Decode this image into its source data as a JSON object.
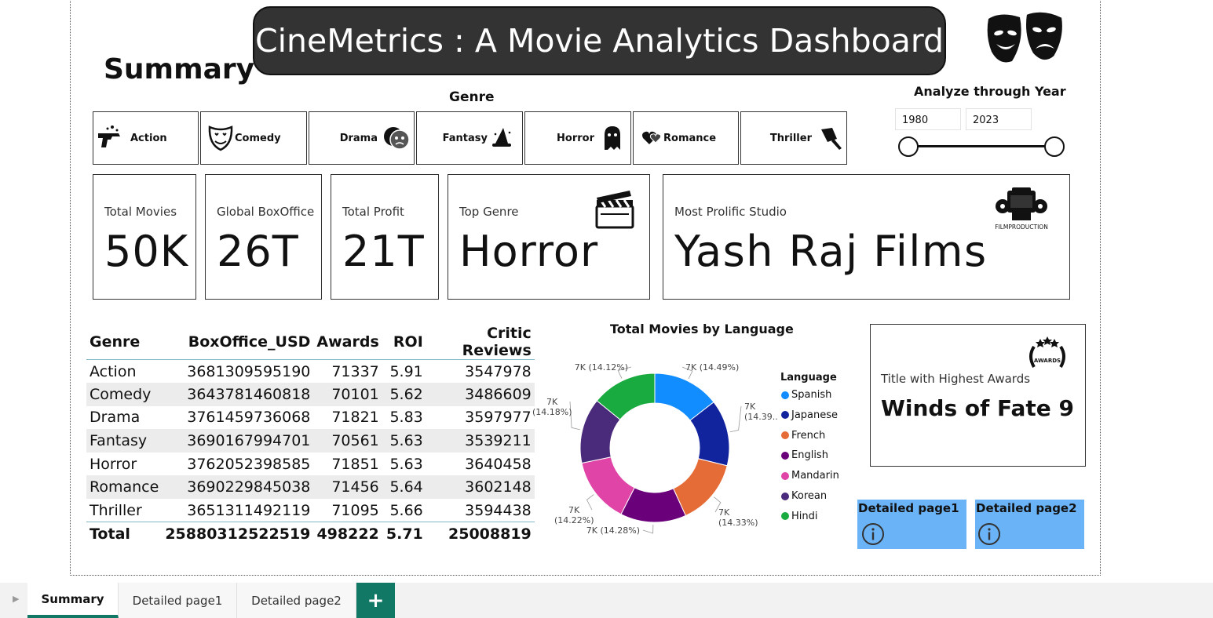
{
  "banner": {
    "title": "CineMetrics : A Movie Analytics Dashboard"
  },
  "page": {
    "heading": "Summary"
  },
  "genre_slicer": {
    "title": "Genre",
    "items": [
      {
        "label": "Action",
        "icon": "gun-icon"
      },
      {
        "label": "Comedy",
        "icon": "jester-mask-icon"
      },
      {
        "label": "Drama",
        "icon": "theatre-masks-icon"
      },
      {
        "label": "Fantasy",
        "icon": "witch-hat-icon"
      },
      {
        "label": "Horror",
        "icon": "ghost-icon"
      },
      {
        "label": "Romance",
        "icon": "hearts-icon"
      },
      {
        "label": "Thriller",
        "icon": "cleaver-icon"
      }
    ]
  },
  "year_slicer": {
    "title": "Analyze through Year",
    "from": "1980",
    "to": "2023"
  },
  "kpis": {
    "total_movies": {
      "label": "Total Movies",
      "value": "50K"
    },
    "global_boxoffice": {
      "label": "Global BoxOffice",
      "value": "26T"
    },
    "total_profit": {
      "label": "Total Profit",
      "value": "21T"
    },
    "top_genre": {
      "label": "Top Genre",
      "value": "Horror"
    },
    "prolific_studio": {
      "label": "Most Prolific Studio",
      "value": "Yash Raj Films",
      "logo_text": "FILMPRODUCTION"
    }
  },
  "genre_table": {
    "columns": [
      "Genre",
      "BoxOffice_USD",
      "Awards",
      "ROI",
      "Critic Reviews"
    ],
    "rows": [
      [
        "Action",
        "3681309595190",
        "71337",
        "5.91",
        "3547978"
      ],
      [
        "Comedy",
        "3643781460818",
        "70101",
        "5.62",
        "3486609"
      ],
      [
        "Drama",
        "3761459736068",
        "71821",
        "5.83",
        "3597977"
      ],
      [
        "Fantasy",
        "3690167994701",
        "70561",
        "5.63",
        "3539211"
      ],
      [
        "Horror",
        "3762052398585",
        "71851",
        "5.63",
        "3640458"
      ],
      [
        "Romance",
        "3690229845038",
        "71456",
        "5.64",
        "3602148"
      ],
      [
        "Thriller",
        "3651311492119",
        "71095",
        "5.66",
        "3594438"
      ]
    ],
    "total": [
      "Total",
      "25880312522519",
      "498222",
      "5.71",
      "25008819"
    ]
  },
  "chart_data": {
    "type": "pie",
    "title": "Total Movies by Language",
    "legend_title": "Language",
    "legend_position": "right",
    "categories": [
      "Spanish",
      "Japanese",
      "French",
      "English",
      "Mandarin",
      "Korean",
      "Hindi"
    ],
    "values": [
      14.49,
      14.39,
      14.33,
      14.28,
      14.22,
      14.18,
      14.12
    ],
    "colors": [
      "#118dff",
      "#12239e",
      "#e66c37",
      "#6b007b",
      "#e044a7",
      "#4a2a7a",
      "#1aab40"
    ],
    "data_labels": [
      "7K (14.49%)",
      "7K (14.39...)",
      "7K (14.33%)",
      "7K (14.28%)",
      "7K (14.22%)",
      "7K (14.18%)",
      "7K (14.12%)"
    ]
  },
  "award_card": {
    "label": "Title with Highest Awards",
    "value": "Winds of Fate 9",
    "badge_text": "AWARDS"
  },
  "nav_buttons": [
    {
      "label": "Detailed page1"
    },
    {
      "label": "Detailed page2"
    }
  ],
  "tabs": [
    {
      "label": "Summary",
      "active": true
    },
    {
      "label": "Detailed page1",
      "active": false
    },
    {
      "label": "Detailed page2",
      "active": false
    }
  ],
  "add_tab": "+",
  "tab_scroll_icon": "scroll-left-icon"
}
